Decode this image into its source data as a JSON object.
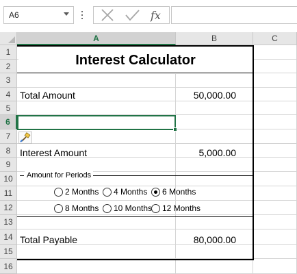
{
  "formula_bar": {
    "name_box": "A6",
    "cancel_icon": "✕",
    "enter_icon": "✓",
    "fx_label": "fx",
    "formula": ""
  },
  "columns": [
    "A",
    "B",
    "C"
  ],
  "rows": [
    "1",
    "2",
    "3",
    "4",
    "5",
    "6",
    "7",
    "8",
    "9",
    "10",
    "11",
    "12",
    "13",
    "14",
    "15",
    "16"
  ],
  "active_cell": "A6",
  "sheet": {
    "title": "Interest Calculator",
    "total_amount_label": "Total Amount",
    "total_amount_value": "50,000.00",
    "interest_amount_label": "Interest Amount",
    "interest_amount_value": "5,000.00",
    "total_payable_label": "Total Payable",
    "total_payable_value": "80,000.00"
  },
  "group_box": {
    "caption": "Amount for Periods",
    "options": [
      {
        "label": "2 Months",
        "checked": false
      },
      {
        "label": "4 Months",
        "checked": false
      },
      {
        "label": "6 Months",
        "checked": true
      },
      {
        "label": "8 Months",
        "checked": false
      },
      {
        "label": "10 Months",
        "checked": false
      },
      {
        "label": "12 Months",
        "checked": false
      }
    ]
  },
  "colors": {
    "accent": "#217346",
    "header_bg": "#e6e6e6",
    "gridline": "#d4d4d4"
  }
}
